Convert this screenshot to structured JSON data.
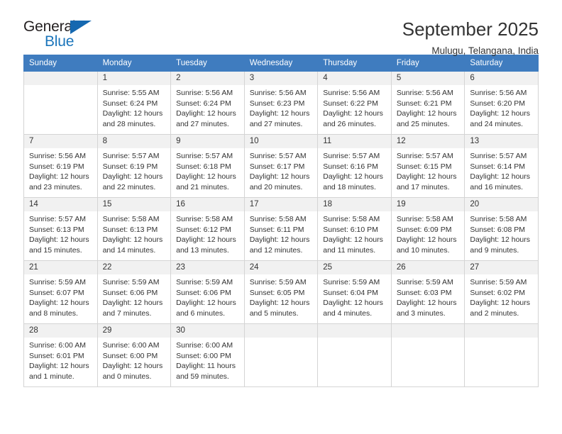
{
  "brand": {
    "name_top": "General",
    "name_bottom": "Blue",
    "color_dark": "#231f20",
    "color_blue": "#1b75bb"
  },
  "header": {
    "title": "September 2025",
    "subtitle": "Mulugu, Telangana, India"
  },
  "theme": {
    "header_bg": "#3f7cbf",
    "header_text": "#ffffff",
    "daynum_bg": "#f1f1f1",
    "grid_line": "#d4d4d4",
    "cell_bg": "#ffffff",
    "text": "#333333"
  },
  "weekdays": [
    "Sunday",
    "Monday",
    "Tuesday",
    "Wednesday",
    "Thursday",
    "Friday",
    "Saturday"
  ],
  "weeks": [
    [
      {
        "day": "",
        "lines": []
      },
      {
        "day": "1",
        "lines": [
          "Sunrise: 5:55 AM",
          "Sunset: 6:24 PM",
          "Daylight: 12 hours",
          "and 28 minutes."
        ]
      },
      {
        "day": "2",
        "lines": [
          "Sunrise: 5:56 AM",
          "Sunset: 6:24 PM",
          "Daylight: 12 hours",
          "and 27 minutes."
        ]
      },
      {
        "day": "3",
        "lines": [
          "Sunrise: 5:56 AM",
          "Sunset: 6:23 PM",
          "Daylight: 12 hours",
          "and 27 minutes."
        ]
      },
      {
        "day": "4",
        "lines": [
          "Sunrise: 5:56 AM",
          "Sunset: 6:22 PM",
          "Daylight: 12 hours",
          "and 26 minutes."
        ]
      },
      {
        "day": "5",
        "lines": [
          "Sunrise: 5:56 AM",
          "Sunset: 6:21 PM",
          "Daylight: 12 hours",
          "and 25 minutes."
        ]
      },
      {
        "day": "6",
        "lines": [
          "Sunrise: 5:56 AM",
          "Sunset: 6:20 PM",
          "Daylight: 12 hours",
          "and 24 minutes."
        ]
      }
    ],
    [
      {
        "day": "7",
        "lines": [
          "Sunrise: 5:56 AM",
          "Sunset: 6:19 PM",
          "Daylight: 12 hours",
          "and 23 minutes."
        ]
      },
      {
        "day": "8",
        "lines": [
          "Sunrise: 5:57 AM",
          "Sunset: 6:19 PM",
          "Daylight: 12 hours",
          "and 22 minutes."
        ]
      },
      {
        "day": "9",
        "lines": [
          "Sunrise: 5:57 AM",
          "Sunset: 6:18 PM",
          "Daylight: 12 hours",
          "and 21 minutes."
        ]
      },
      {
        "day": "10",
        "lines": [
          "Sunrise: 5:57 AM",
          "Sunset: 6:17 PM",
          "Daylight: 12 hours",
          "and 20 minutes."
        ]
      },
      {
        "day": "11",
        "lines": [
          "Sunrise: 5:57 AM",
          "Sunset: 6:16 PM",
          "Daylight: 12 hours",
          "and 18 minutes."
        ]
      },
      {
        "day": "12",
        "lines": [
          "Sunrise: 5:57 AM",
          "Sunset: 6:15 PM",
          "Daylight: 12 hours",
          "and 17 minutes."
        ]
      },
      {
        "day": "13",
        "lines": [
          "Sunrise: 5:57 AM",
          "Sunset: 6:14 PM",
          "Daylight: 12 hours",
          "and 16 minutes."
        ]
      }
    ],
    [
      {
        "day": "14",
        "lines": [
          "Sunrise: 5:57 AM",
          "Sunset: 6:13 PM",
          "Daylight: 12 hours",
          "and 15 minutes."
        ]
      },
      {
        "day": "15",
        "lines": [
          "Sunrise: 5:58 AM",
          "Sunset: 6:13 PM",
          "Daylight: 12 hours",
          "and 14 minutes."
        ]
      },
      {
        "day": "16",
        "lines": [
          "Sunrise: 5:58 AM",
          "Sunset: 6:12 PM",
          "Daylight: 12 hours",
          "and 13 minutes."
        ]
      },
      {
        "day": "17",
        "lines": [
          "Sunrise: 5:58 AM",
          "Sunset: 6:11 PM",
          "Daylight: 12 hours",
          "and 12 minutes."
        ]
      },
      {
        "day": "18",
        "lines": [
          "Sunrise: 5:58 AM",
          "Sunset: 6:10 PM",
          "Daylight: 12 hours",
          "and 11 minutes."
        ]
      },
      {
        "day": "19",
        "lines": [
          "Sunrise: 5:58 AM",
          "Sunset: 6:09 PM",
          "Daylight: 12 hours",
          "and 10 minutes."
        ]
      },
      {
        "day": "20",
        "lines": [
          "Sunrise: 5:58 AM",
          "Sunset: 6:08 PM",
          "Daylight: 12 hours",
          "and 9 minutes."
        ]
      }
    ],
    [
      {
        "day": "21",
        "lines": [
          "Sunrise: 5:59 AM",
          "Sunset: 6:07 PM",
          "Daylight: 12 hours",
          "and 8 minutes."
        ]
      },
      {
        "day": "22",
        "lines": [
          "Sunrise: 5:59 AM",
          "Sunset: 6:06 PM",
          "Daylight: 12 hours",
          "and 7 minutes."
        ]
      },
      {
        "day": "23",
        "lines": [
          "Sunrise: 5:59 AM",
          "Sunset: 6:06 PM",
          "Daylight: 12 hours",
          "and 6 minutes."
        ]
      },
      {
        "day": "24",
        "lines": [
          "Sunrise: 5:59 AM",
          "Sunset: 6:05 PM",
          "Daylight: 12 hours",
          "and 5 minutes."
        ]
      },
      {
        "day": "25",
        "lines": [
          "Sunrise: 5:59 AM",
          "Sunset: 6:04 PM",
          "Daylight: 12 hours",
          "and 4 minutes."
        ]
      },
      {
        "day": "26",
        "lines": [
          "Sunrise: 5:59 AM",
          "Sunset: 6:03 PM",
          "Daylight: 12 hours",
          "and 3 minutes."
        ]
      },
      {
        "day": "27",
        "lines": [
          "Sunrise: 5:59 AM",
          "Sunset: 6:02 PM",
          "Daylight: 12 hours",
          "and 2 minutes."
        ]
      }
    ],
    [
      {
        "day": "28",
        "lines": [
          "Sunrise: 6:00 AM",
          "Sunset: 6:01 PM",
          "Daylight: 12 hours",
          "and 1 minute."
        ]
      },
      {
        "day": "29",
        "lines": [
          "Sunrise: 6:00 AM",
          "Sunset: 6:00 PM",
          "Daylight: 12 hours",
          "and 0 minutes."
        ]
      },
      {
        "day": "30",
        "lines": [
          "Sunrise: 6:00 AM",
          "Sunset: 6:00 PM",
          "Daylight: 11 hours",
          "and 59 minutes."
        ]
      },
      {
        "day": "",
        "lines": []
      },
      {
        "day": "",
        "lines": []
      },
      {
        "day": "",
        "lines": []
      },
      {
        "day": "",
        "lines": []
      }
    ]
  ]
}
